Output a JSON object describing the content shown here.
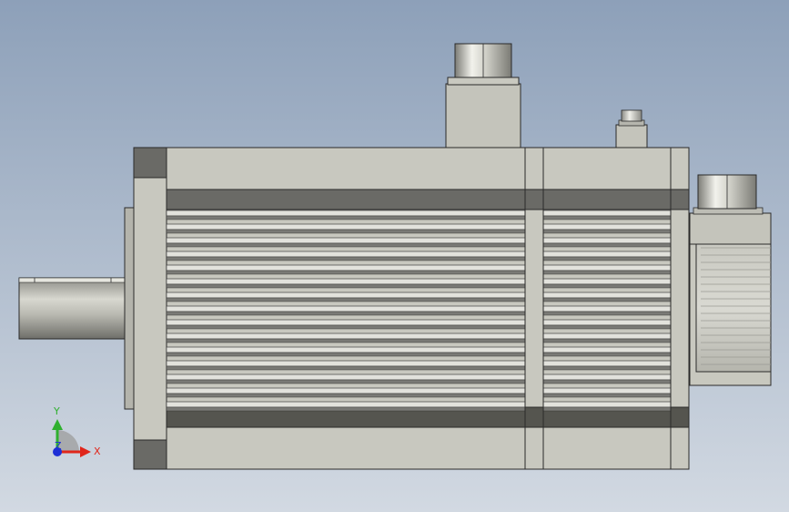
{
  "viewport": {
    "background_top": "#8da0b9",
    "background_bottom": "#d2d9e2"
  },
  "model": {
    "body_color": "#c8c8bf",
    "outline_color": "#2a2a2a",
    "dark_band_color": "#5a5a57",
    "fin_dark_color": "#7a7a76",
    "fin_light_color": "#e2e2dc"
  },
  "triad": {
    "x_label": "X",
    "y_label": "Y",
    "z_label": "Z",
    "x_color": "#e0261b",
    "y_color": "#2fb02f",
    "z_color": "#1e2fd6"
  }
}
